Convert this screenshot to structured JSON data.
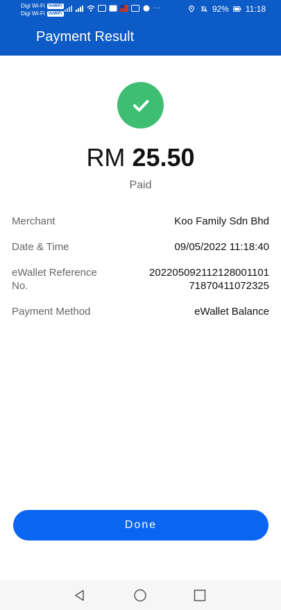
{
  "status_bar": {
    "carrier_1": "Digi Wi-Fi",
    "carrier_2": "Digi Wi-Fi",
    "vowifi": "VoWiFi",
    "battery": "92%",
    "time": "11:18"
  },
  "header": {
    "title": "Payment Result"
  },
  "result": {
    "currency": "RM",
    "amount": "25.50",
    "status": "Paid"
  },
  "details": [
    {
      "label": "Merchant",
      "value": "Koo Family Sdn Bhd"
    },
    {
      "label": "Date & Time",
      "value": "09/05/2022 11:18:40"
    },
    {
      "label": "eWallet Reference",
      "label_line2": "No.",
      "value": "202205092112128001101",
      "value_line2": "71870411072325"
    },
    {
      "label": "Payment Method",
      "value": "eWallet Balance"
    }
  ],
  "actions": {
    "done_label": "Done"
  },
  "colors": {
    "header": "#0d5bc6",
    "success": "#3dbe73",
    "button": "#0a66f0"
  },
  "icons": {
    "success": "check-icon",
    "nav_back": "back-triangle-icon",
    "nav_home": "home-circle-icon",
    "nav_recent": "recent-square-icon"
  }
}
